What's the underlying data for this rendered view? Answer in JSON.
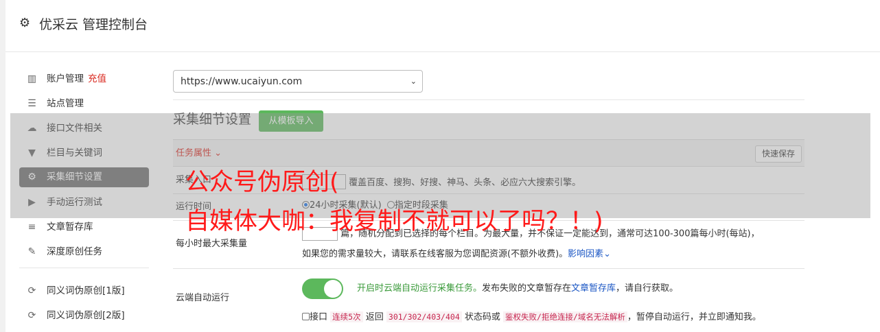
{
  "header": {
    "title": "优采云 管理控制台",
    "icon": "gear-icon"
  },
  "sidebar": {
    "items": [
      {
        "label": "账户管理",
        "extra": "充值",
        "icon": "bar-chart-icon"
      },
      {
        "label": "站点管理",
        "icon": "server-icon"
      },
      {
        "label": "接口文件相关",
        "icon": "cloud-upload-icon"
      },
      {
        "label": "栏目与关键词",
        "icon": "filter-icon"
      },
      {
        "label": "采集细节设置",
        "icon": "gears-icon",
        "active": true
      },
      {
        "label": "手动运行测试",
        "icon": "play-circle-icon"
      },
      {
        "label": "文章暂存库",
        "icon": "database-icon"
      },
      {
        "label": "深度原创任务",
        "icon": "edit-icon"
      },
      {
        "label": "同义词伪原创[1版]",
        "icon": "refresh-icon"
      },
      {
        "label": "同义词伪原创[2版]",
        "icon": "refresh-icon"
      }
    ]
  },
  "site_select": {
    "value": "https://www.ucaiyun.com"
  },
  "section": {
    "title": "采集细节设置",
    "import_button": "从模板导入"
  },
  "table": {
    "property_label": "任务属性",
    "save_button": "快速保存",
    "rows": {
      "source": {
        "label": "采集入口",
        "value": "覆盖百度、搜狗、好搜、神马、头条、必应六大搜索引擎。"
      },
      "runtime": {
        "label": "运行时间",
        "option1": "24小时采集(默认)",
        "option2": "指定时段采集"
      },
      "max": {
        "label": "每小时最大采集量",
        "line1_a": "篇，随机分配到已选择的每个栏目。",
        "line1_b": "为最大量，并不保证一定能达到，通常可达100-300篇每小时(每站)，",
        "line2": "如果您的需求量较大，请联系在线客服为您调配资源(不额外收费)。",
        "link": "影响因素"
      },
      "cloud": {
        "label": "云端自动运行",
        "text1": "开启时云端自动运行采集任务。",
        "text2": "发布失败的文章暂存在",
        "link": "文章暂存库",
        "text3": "，请自行获取。",
        "check_a": "接口",
        "code1": "连续5次",
        "check_b": "返回",
        "code2": "301/302/403/404",
        "check_c": "状态码或",
        "code3": "鉴权失败/拒绝连接/域名无法解析",
        "check_d": "，暂停自动运行，并立即通知我。"
      }
    }
  },
  "watermark": {
    "line1": "公众号伪原创(",
    "line2": "自媒体大咖：我复制不就可以了吗？！)"
  }
}
